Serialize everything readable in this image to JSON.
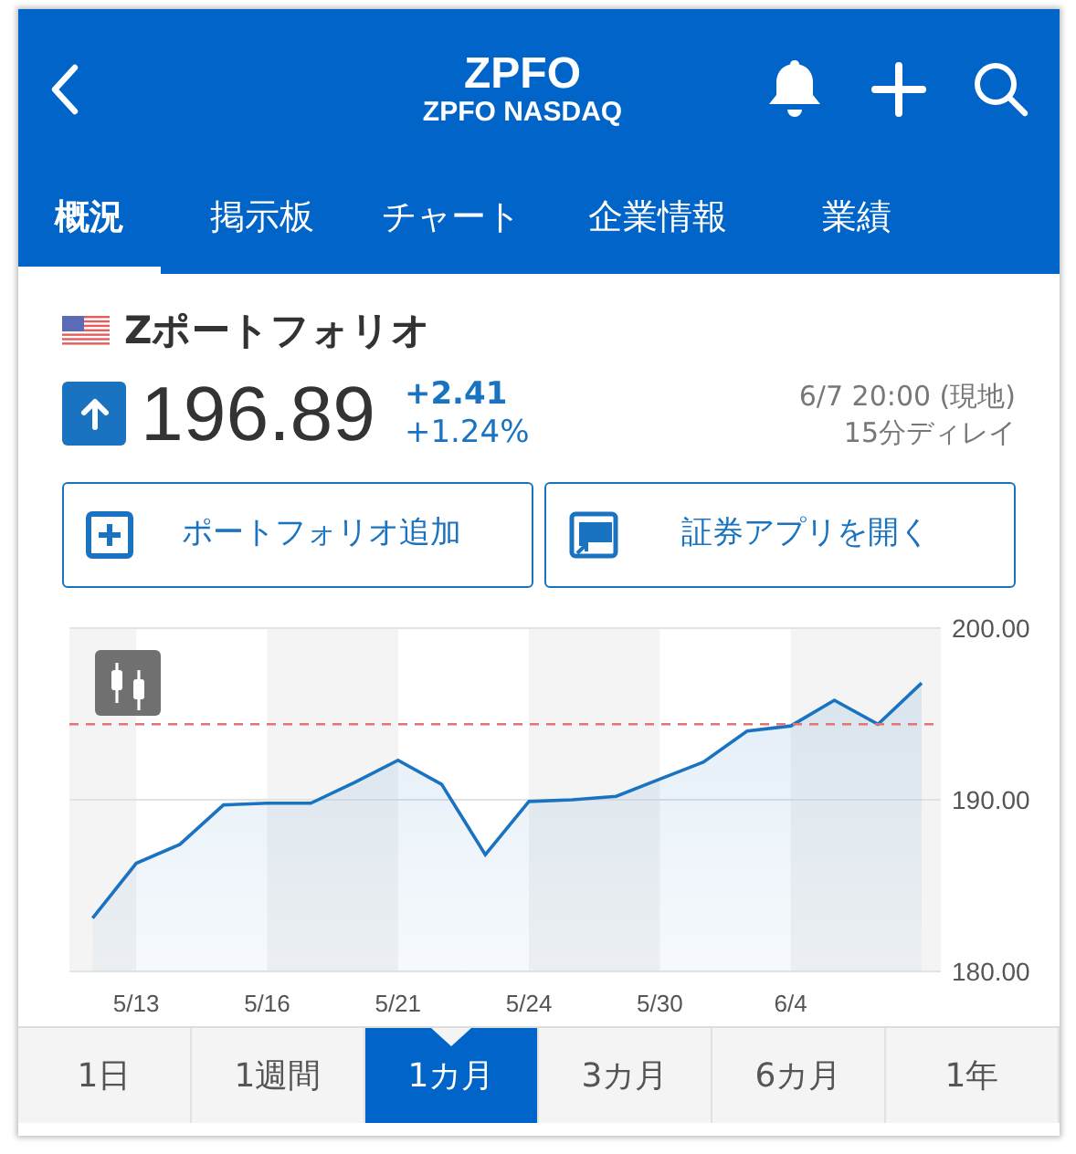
{
  "header": {
    "title": "ZPFO",
    "subtitle": "ZPFO NASDAQ"
  },
  "tabs": [
    {
      "label": "概況",
      "selected": true
    },
    {
      "label": "掲示板",
      "selected": false
    },
    {
      "label": "チャート",
      "selected": false
    },
    {
      "label": "企業情報",
      "selected": false
    },
    {
      "label": "業績",
      "selected": false
    }
  ],
  "stock": {
    "name": "Zポートフォリオ",
    "price": "196.89",
    "up": true,
    "change": "+2.41",
    "change_percent": "+1.24%",
    "time": "6/7 20:00 (現地)",
    "delay": "15分ディレイ"
  },
  "actions": [
    {
      "kind": "add",
      "label": "ポートフォリオ追加"
    },
    {
      "kind": "app",
      "label": "証券アプリを開く"
    }
  ],
  "chart_data": {
    "type": "area",
    "categories": [
      null,
      "5/13",
      null,
      null,
      "5/16",
      null,
      null,
      "5/21",
      null,
      null,
      "5/24",
      null,
      null,
      "5/30",
      null,
      null,
      "6/4",
      null,
      null,
      null
    ],
    "series": [
      {
        "color": "#1a73c0",
        "values": [
          183.1,
          186.3,
          187.4,
          189.7,
          189.8,
          189.8,
          191.0,
          192.3,
          190.9,
          186.8,
          189.9,
          190.0,
          190.2,
          191.2,
          192.2,
          194.0,
          194.3,
          195.8,
          194.4,
          196.8
        ]
      }
    ],
    "ylim": [
      180,
      200
    ],
    "yticks": [
      {
        "value": 180,
        "label": "180.00"
      },
      {
        "value": 190,
        "label": "190.00"
      },
      {
        "value": 200,
        "label": "200.00"
      }
    ],
    "ref_lines": [
      {
        "axis": "y",
        "value": 194.4,
        "color": "#e57373"
      }
    ]
  },
  "periods": [
    {
      "label": "1日",
      "selected": false
    },
    {
      "label": "1週間",
      "selected": false
    },
    {
      "label": "1カ月",
      "selected": true
    },
    {
      "label": "3カ月",
      "selected": false
    },
    {
      "label": "6カ月",
      "selected": false
    },
    {
      "label": "1年",
      "selected": false
    }
  ]
}
